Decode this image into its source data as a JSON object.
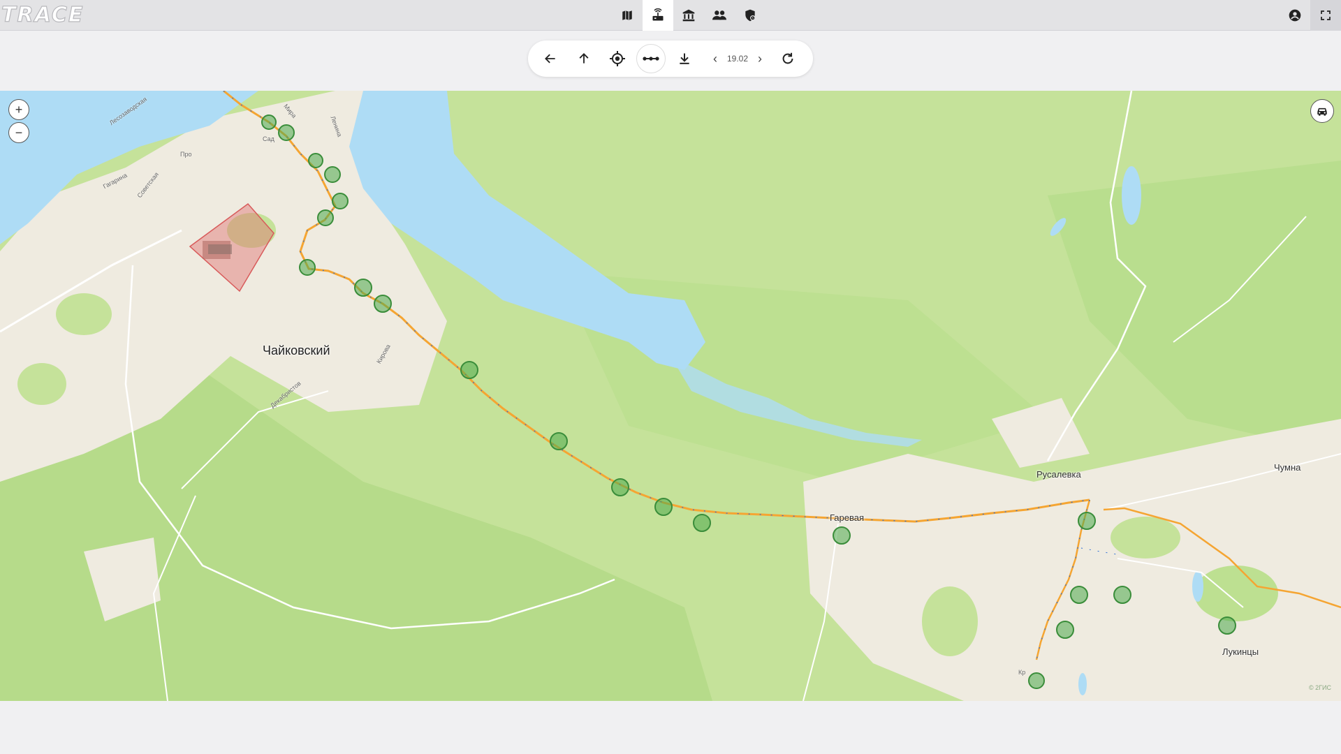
{
  "app": {
    "logo_text": "TRACE"
  },
  "topnav": {
    "items": [
      {
        "name": "map-icon",
        "active": false
      },
      {
        "name": "tracker-icon",
        "active": true
      },
      {
        "name": "building-icon",
        "active": false
      },
      {
        "name": "users-icon",
        "active": false
      },
      {
        "name": "security-icon",
        "active": false
      }
    ],
    "right": [
      {
        "name": "account-icon"
      },
      {
        "name": "fullscreen-icon"
      }
    ]
  },
  "toolbar": {
    "date": "19.02",
    "prev_arrow": "‹",
    "next_arrow": "›"
  },
  "map": {
    "places": {
      "chaykovsky": "Чайковский",
      "rusalevka": "Русалевка",
      "chumna": "Чумна",
      "gareva": "Гаревая",
      "lukintsy": "Лукинцы"
    },
    "streets": {
      "mira": "Мира",
      "lenina": "Ленина",
      "gagarina": "Гагарина",
      "sovetskaya": "Советская",
      "kirova": "Кирова",
      "dekabristov": "Декабристов",
      "lesozavodskaya": "Лесозаводская",
      "pro": "Про",
      "sad": "Сад",
      "kr": "Кр"
    },
    "zoom_in": "+",
    "zoom_out": "−",
    "copyright": "© 2ГИС",
    "colors": {
      "forest": "#c5e29a",
      "forest_dark": "#a9d27f",
      "urban": "#efebe0",
      "water": "#aedcf5",
      "route": "#f5a532",
      "track": "#2f6fd6",
      "stop": "#4caa4c",
      "geofence": "#e07070"
    }
  }
}
